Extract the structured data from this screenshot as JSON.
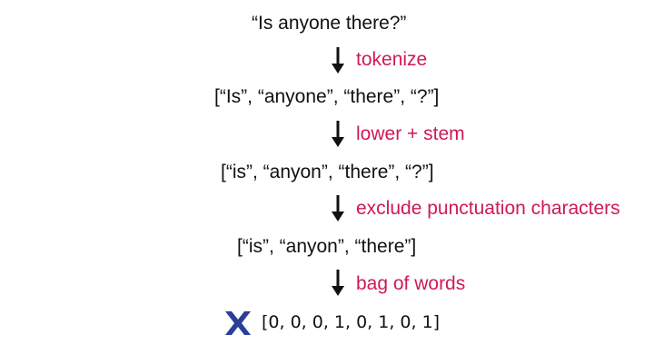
{
  "pipeline": {
    "input": "“Is anyone there?”",
    "steps": [
      {
        "label": "tokenize",
        "result": "[“Is”,  “anyone”, “there”, “?”]"
      },
      {
        "label": "lower + stem",
        "result": "[“is”,  “anyon”, “there”, “?”]"
      },
      {
        "label": "exclude punctuation characters",
        "result": "[“is”,  “anyon”, “there”]"
      },
      {
        "label": "bag of words"
      }
    ],
    "output_vector": "[0, 0, 0, 1, 0, 1, 0, 1]",
    "output_marker_icon": "x-icon"
  },
  "colors": {
    "step_label": "#cf1a52",
    "arrow": "#111111",
    "x_marker": "#2a3e9a",
    "text": "#111111"
  }
}
